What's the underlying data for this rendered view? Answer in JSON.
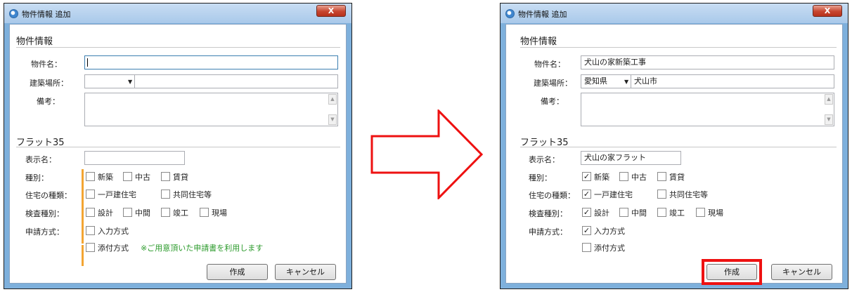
{
  "dialog_before": {
    "title": "物件情報 追加",
    "close_label": "X",
    "section_property": "物件情報",
    "label_name": "物件名：",
    "name_value": "",
    "label_location": "建築場所：",
    "prefecture_value": "",
    "city_value": "",
    "label_remarks": "備考：",
    "remarks_value": "",
    "section_flat35": "フラット35",
    "label_display_name": "表示名：",
    "display_name_value": "",
    "label_type": "種別：",
    "type_options": [
      {
        "label": "新築",
        "checked": false
      },
      {
        "label": "中古",
        "checked": false
      },
      {
        "label": "賃貸",
        "checked": false
      }
    ],
    "label_housing_type": "住宅の種類：",
    "housing_options": [
      {
        "label": "一戸建住宅",
        "checked": false
      },
      {
        "label": "共同住宅等",
        "checked": false
      }
    ],
    "label_inspection_type": "検査種別：",
    "inspection_options": [
      {
        "label": "設計",
        "checked": false
      },
      {
        "label": "中間",
        "checked": false
      },
      {
        "label": "竣工",
        "checked": false
      },
      {
        "label": "現場",
        "checked": false
      }
    ],
    "label_application_method": "申請方式：",
    "application_options": [
      {
        "label": "入力方式",
        "checked": false
      },
      {
        "label": "添付方式",
        "checked": false
      }
    ],
    "attachment_note": "※ご用意頂いた申請書を利用します",
    "create_label": "作成",
    "cancel_label": "キャンセル"
  },
  "dialog_after": {
    "title": "物件情報 追加",
    "close_label": "X",
    "section_property": "物件情報",
    "label_name": "物件名：",
    "name_value": "犬山の家新築工事",
    "label_location": "建築場所：",
    "prefecture_value": "愛知県",
    "city_value": "犬山市",
    "label_remarks": "備考：",
    "remarks_value": "",
    "section_flat35": "フラット35",
    "label_display_name": "表示名：",
    "display_name_value": "犬山の家フラット",
    "label_type": "種別：",
    "type_options": [
      {
        "label": "新築",
        "checked": true
      },
      {
        "label": "中古",
        "checked": false
      },
      {
        "label": "賃貸",
        "checked": false
      }
    ],
    "label_housing_type": "住宅の種類：",
    "housing_options": [
      {
        "label": "一戸建住宅",
        "checked": true
      },
      {
        "label": "共同住宅等",
        "checked": false
      }
    ],
    "label_inspection_type": "検査種別：",
    "inspection_options": [
      {
        "label": "設計",
        "checked": true
      },
      {
        "label": "中間",
        "checked": false
      },
      {
        "label": "竣工",
        "checked": false
      },
      {
        "label": "現場",
        "checked": false
      }
    ],
    "label_application_method": "申請方式：",
    "application_options": [
      {
        "label": "入力方式",
        "checked": true
      },
      {
        "label": "添付方式",
        "checked": false
      }
    ],
    "create_label": "作成",
    "cancel_label": "キャンセル"
  },
  "colors": {
    "required_marker": "#f3a532",
    "note_green": "#2a9a2a",
    "highlight_red": "#ee1111",
    "titlebar_blue": "#a9c9ea"
  },
  "icons": {
    "arrow": "right-arrow-outline-icon",
    "checkmark": "✓"
  }
}
